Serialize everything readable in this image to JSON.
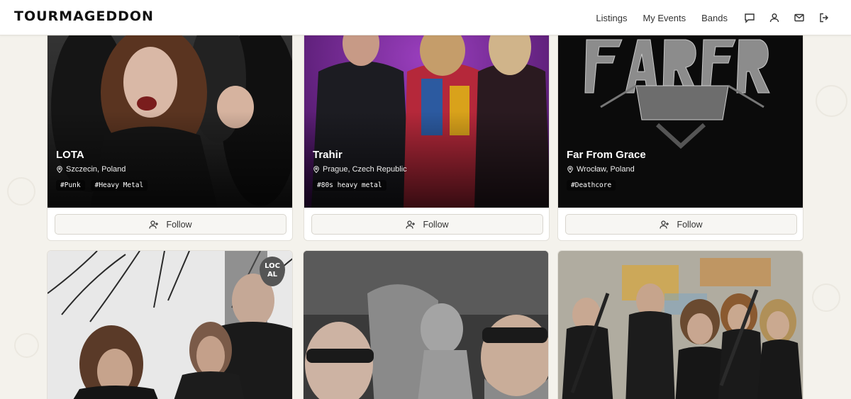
{
  "header": {
    "logo": "TOURMAGEDDON",
    "nav": [
      "Listings",
      "My Events",
      "Bands"
    ],
    "icons": [
      "chat-icon",
      "user-icon",
      "mail-icon",
      "logout-icon"
    ]
  },
  "bands": [
    {
      "name": "LOTA",
      "location": "Szczecin, Poland",
      "tags": [
        "#Punk",
        "#Heavy Metal"
      ],
      "follow": "Follow"
    },
    {
      "name": "Trahir",
      "location": "Prague, Czech Republic",
      "tags": [
        "#80s heavy metal"
      ],
      "follow": "Follow"
    },
    {
      "name": "Far From Grace",
      "location": "Wrocław, Poland",
      "tags": [
        "#Deathcore"
      ],
      "follow": "Follow"
    }
  ],
  "second_row": {
    "local_badge": [
      "LOC",
      "AL"
    ]
  },
  "colors": {
    "background": "#f4f2ec",
    "card": "#ffffff",
    "trahir_purple": "#6a1d8a"
  }
}
